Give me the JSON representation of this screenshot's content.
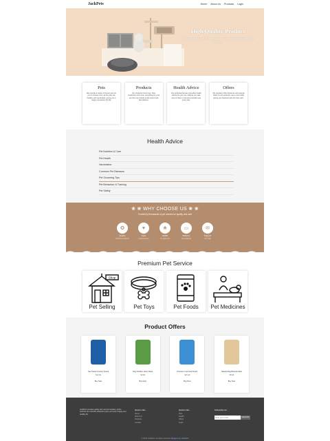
{
  "nav": {
    "logo": "JackPets",
    "links": [
      "Home",
      "About Us",
      "Products",
      "Login"
    ]
  },
  "hero": {
    "title": "High Quality Product",
    "subtitle": "We provide you with supplies for all the pets and cats for pet owners"
  },
  "features": [
    {
      "title": "Pets",
      "text": "We provide a variety of lovely pets for you to choose from, all the pets are healthy and vaccinated, giving you a happy companion for life."
    },
    {
      "title": "Products",
      "text": "Our products cover toys, food, medicines and more, everything for your pet from top brands at fair prices with fast delivery."
    },
    {
      "title": "Health Advice",
      "text": "Our professional team provides health advice for your pet, helping you take care of them in the best possible way every day."
    },
    {
      "title": "Offers",
      "text": "We regularly offer discounts and special deals on pet products, save more while giving your beloved pets the best care."
    }
  ],
  "health": {
    "title": "Health Advice",
    "items": [
      "Pet Nutrition & Care",
      "Pet Health",
      "Vaccination",
      "Common Pet Diseases",
      "Pet Grooming Tips",
      "Pet Behaviour & Training",
      "Pet Safety"
    ],
    "active_index": 4
  },
  "why": {
    "title": "WHY CHOOSE US",
    "subtitle": "Trusted by thousands of pet owners for quality and care",
    "items": [
      {
        "label": "Quality",
        "desc": "Premium products",
        "icon": "award-icon"
      },
      {
        "label": "Care",
        "desc": "Loving service",
        "icon": "heart-icon"
      },
      {
        "label": "Health",
        "desc": "Vet approved",
        "icon": "paw-icon"
      },
      {
        "label": "Delivery",
        "desc": "Fast shipping",
        "icon": "truck-icon"
      },
      {
        "label": "Support",
        "desc": "24/7 help",
        "icon": "chat-icon"
      }
    ],
    "color": "#b38d6d"
  },
  "premium": {
    "title": "Premium Pet Service",
    "services": [
      {
        "label": "Pet Selling",
        "icon": "shop-icon",
        "shop_sign": "Shop"
      },
      {
        "label": "Pet Toys",
        "icon": "collar-icon"
      },
      {
        "label": "Pet Foods",
        "icon": "food-bag-icon"
      },
      {
        "label": "Pet Medicines",
        "icon": "vet-icon"
      }
    ]
  },
  "offers": {
    "title": "Product Offers",
    "products": [
      {
        "name": "Cat Treats Crunchy Snack",
        "price": "$12.99",
        "button": "Buy Now",
        "color": "#1f5fa8"
      },
      {
        "name": "Dog Chicken Jerky Strips",
        "price": "$9.99",
        "button": "Buy Now",
        "color": "#5a9c46"
      },
      {
        "name": "Premium Cat Food Pouch",
        "price": "$15.49",
        "button": "Buy Now",
        "color": "#3d8fd6"
      },
      {
        "name": "Natural Dog Biscuits Pack",
        "price": "$8.99",
        "button": "Buy Now",
        "color": "#e2c79a"
      }
    ]
  },
  "footer": {
    "about": "JackPets provides quality pets and pet supplies, all the products are carefully selected to give your pets a happy and healthy life.",
    "col1_title": "Quick Links",
    "col1_links": [
      "Home",
      "About Us",
      "Products",
      "Contact"
    ],
    "col2_title": "Quick Links",
    "col2_links": [
      "Pets",
      "Health",
      "Offers",
      "Login"
    ],
    "newsletter_title": "Subscribe Us",
    "newsletter_placeholder": "Enter your email",
    "newsletter_button": "Subscribe",
    "copyright": "© 2023 JackPets. All rights reserved.",
    "credit": "Designed by JackPets"
  }
}
